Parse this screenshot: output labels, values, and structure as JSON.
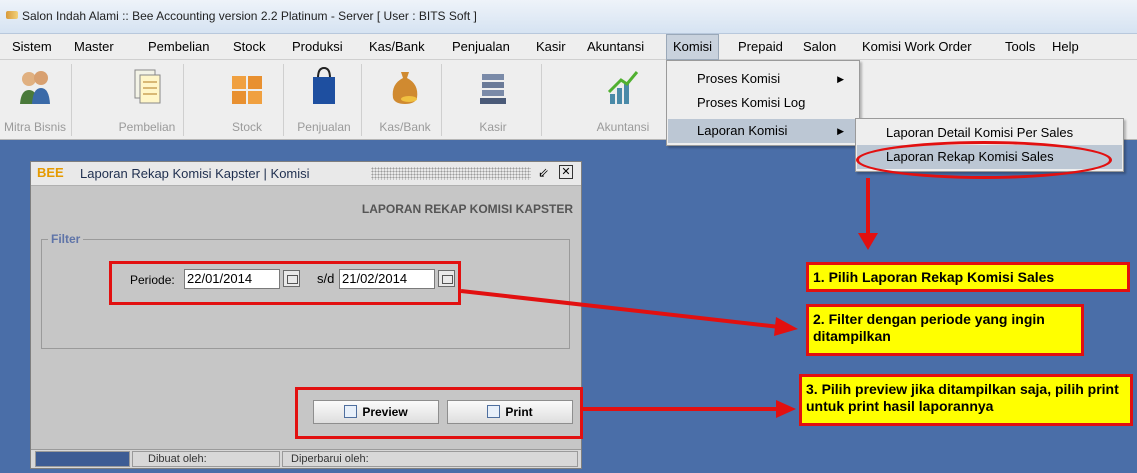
{
  "window": {
    "title": "Salon Indah Alami :: Bee Accounting version 2.2 Platinum - Server  [ User : BITS Soft ]"
  },
  "menubar": [
    "Sistem",
    "Master",
    "Pembelian",
    "Stock",
    "Produksi",
    "Kas/Bank",
    "Penjualan",
    "Kasir",
    "Akuntansi",
    "Komisi",
    "Prepaid",
    "Salon",
    "Komisi Work Order",
    "Tools",
    "Help"
  ],
  "toolbar": [
    "Mitra Bisnis",
    "Pembelian",
    "Stock",
    "Penjualan",
    "Kas/Bank",
    "Kasir",
    "Akuntansi"
  ],
  "komisi_menu": {
    "item1": "Proses Komisi",
    "item2": "Proses Komisi Log",
    "item3": "Laporan Komisi"
  },
  "laporan_submenu": {
    "item1": "Laporan Detail Komisi Per Sales",
    "item2": "Laporan Rekap Komisi Sales"
  },
  "report_window": {
    "logo": "BEE",
    "title": "Laporan Rekap Komisi Kapster | Komisi",
    "heading": "LAPORAN REKAP KOMISI KAPSTER",
    "filter_legend": "Filter",
    "periode_label": "Periode:",
    "date_from": "22/01/2014",
    "sd_label": "s/d",
    "date_to": "21/02/2014",
    "preview_label": "Preview",
    "print_label": "Print",
    "status_created": "Dibuat oleh:",
    "status_updated": "Diperbarui oleh:"
  },
  "annotations": {
    "step1": "1. Pilih Laporan Rekap Komisi Sales",
    "step2": "2. Filter dengan periode yang ingin ditampilkan",
    "step3": "3. Pilih preview jika ditampilkan saja, pilih print untuk print hasil laporannya"
  },
  "colors": {
    "annotation_red": "#e21010",
    "note_yellow": "#ffff00",
    "desktop_blue": "#4a6ea8"
  }
}
